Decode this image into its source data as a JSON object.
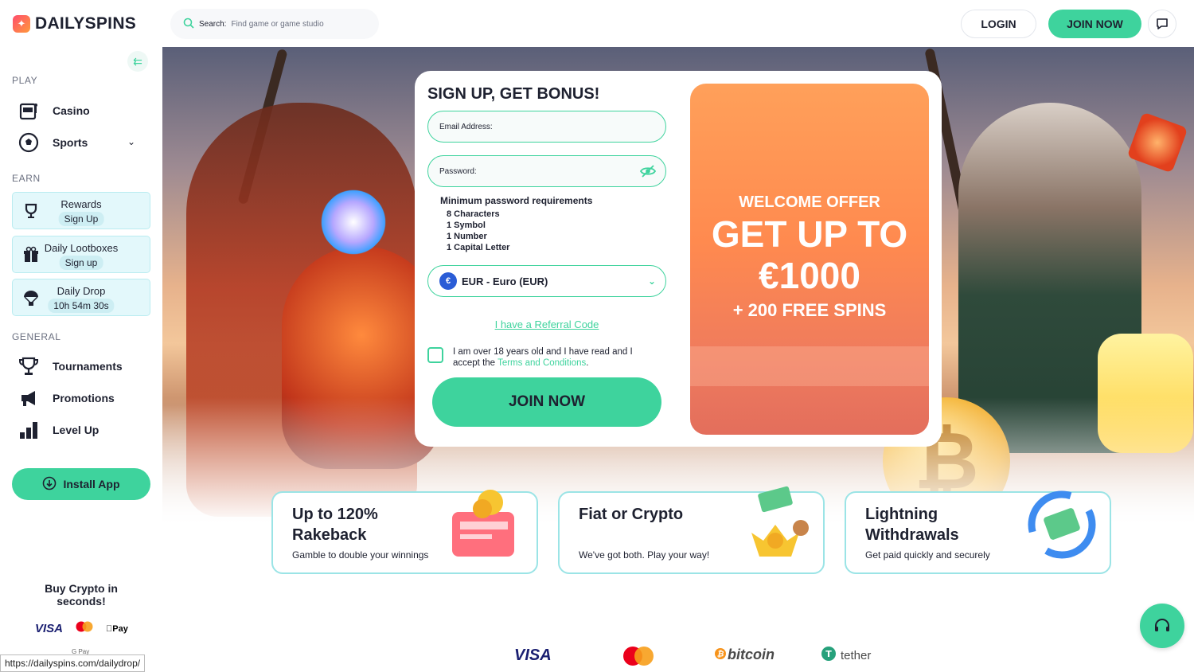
{
  "brand": {
    "name": "DAILYSPINS"
  },
  "header": {
    "search_label": "Search:",
    "search_placeholder": "Find game or game studio",
    "login": "LOGIN",
    "join": "JOIN NOW"
  },
  "sidebar": {
    "play_label": "PLAY",
    "play_items": [
      {
        "label": "Casino",
        "icon": "slot-machine-icon"
      },
      {
        "label": "Sports",
        "icon": "soccer-ball-icon"
      }
    ],
    "earn_label": "EARN",
    "earn_cards": [
      {
        "title": "Rewards",
        "badge": "Sign Up",
        "icon": "trophy-icon"
      },
      {
        "title": "Daily Lootboxes",
        "badge": "Sign up",
        "icon": "gift-icon"
      },
      {
        "title": "Daily Drop",
        "badge": "10h 54m 30s",
        "icon": "parachute-icon"
      }
    ],
    "general_label": "GENERAL",
    "general_items": [
      {
        "label": "Tournaments",
        "icon": "trophy-cup-icon"
      },
      {
        "label": "Promotions",
        "icon": "megaphone-icon"
      },
      {
        "label": "Level Up",
        "icon": "bar-chart-icon"
      }
    ],
    "install_app": "Install App",
    "buy_crypto": "Buy Crypto in seconds!",
    "payment_visa": "VISA",
    "payment_applepay": "Pay",
    "payment_gpay": "G Pay"
  },
  "status_url": "https://dailyspins.com/dailydrop/",
  "signup": {
    "title": "SIGN UP, GET BONUS!",
    "email_placeholder": "Email Address:",
    "password_placeholder": "Password:",
    "requirements_title": "Minimum password requirements",
    "requirements": [
      "8 Characters",
      "1 Symbol",
      "1 Number",
      "1 Capital Letter"
    ],
    "currency": "EUR - Euro (EUR)",
    "currency_symbol": "€",
    "referral": "I have a Referral Code",
    "terms_prefix": "I am over 18 years old and I have read and I accept the ",
    "terms_link": "Terms and Conditions",
    "terms_suffix": ".",
    "join": "JOIN NOW"
  },
  "offer": {
    "welcome": "WELCOME OFFER",
    "line1": "GET UP TO",
    "line2": "€1000",
    "line3": "+ 200 FREE SPINS"
  },
  "features": [
    {
      "title": "Up to 120% Rakeback",
      "desc": "Gamble to double your winnings"
    },
    {
      "title": "Fiat or Crypto",
      "desc": "We've got both. Play your way!"
    },
    {
      "title": "Lightning Withdrawals",
      "desc": "Get paid quickly and securely"
    }
  ],
  "footer_payments": {
    "visa": "VISA",
    "bitcoin": "bitcoin",
    "tether": "tether"
  },
  "colors": {
    "accent": "#3ed39d",
    "text": "#1e2130",
    "offer": "#ff8a4f"
  }
}
